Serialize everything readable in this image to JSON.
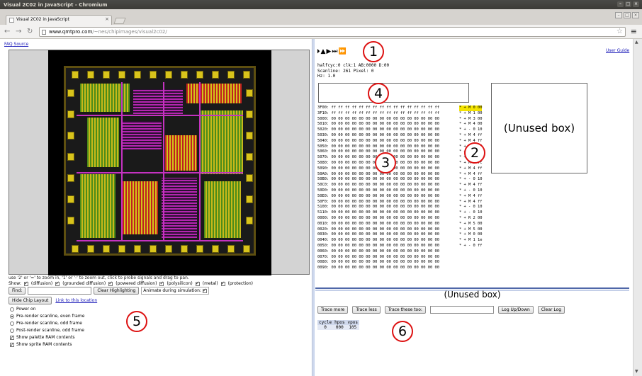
{
  "window": {
    "title": "Visual 2C02 in JavaScript - Chromium"
  },
  "tab": {
    "label": "Visual 2C02 in JavaScript",
    "close": "×"
  },
  "toolbar": {
    "url_host": "www.qmtpro.com",
    "url_path": "/~nes/chipimages/visual2c02/",
    "back": "←",
    "forward": "→",
    "reload": "↻",
    "star": "☆",
    "menu": "≡"
  },
  "links": {
    "faq": "FAQ",
    "source": "Source"
  },
  "chip_area": {
    "help": "use '2' or '=' to zoom in, '1' or '-' to zoom out, click to probe signals and drag to pan.",
    "show_label": "Show:",
    "layers": [
      {
        "label": "(diffusion)",
        "checked": true
      },
      {
        "label": "(grounded diffusion)",
        "checked": true
      },
      {
        "label": "(powered diffusion)",
        "checked": true
      },
      {
        "label": "(polysilicon)",
        "checked": true
      },
      {
        "label": "(metal)",
        "checked": true
      },
      {
        "label": "(protection)",
        "checked": true
      }
    ],
    "find_button": "Find:",
    "clear_button": "Clear Highlighting",
    "animate_label": "Animate during simulation:",
    "animate_checked": true,
    "hide_button": "Hide Chip Layout",
    "link_location": "Link to this location"
  },
  "options": [
    {
      "type": "radio",
      "label": "Power on",
      "checked": false
    },
    {
      "type": "radio",
      "label": "Pre-render scanline, even frame",
      "checked": true
    },
    {
      "type": "radio",
      "label": "Pre-render scanline, odd frame",
      "checked": false
    },
    {
      "type": "radio",
      "label": "Post-render scanline, odd frame",
      "checked": false
    },
    {
      "type": "checkbox",
      "label": "Show palette RAM contents",
      "checked": true
    },
    {
      "type": "checkbox",
      "label": "Show sprite RAM contents",
      "checked": true
    }
  ],
  "controls": {
    "buttons": [
      "⏵",
      "▲",
      "▶",
      "⏭",
      "⏩"
    ],
    "user_guide": "User Guide"
  },
  "status_lines": [
    "halfcyc:0 clk:1 AB:0000 D:00",
    "Scanline: 261 Pixel: 0",
    "Hz: 1.0"
  ],
  "memory_rows": [
    "3F00: ff ff ff ff ff ff ff ff ff ff ff ff ff ff ff ff",
    "3F10: ff ff ff ff ff ff ff ff ff ff ff ff ff ff ff ff",
    "5000: 00 00 00 00 00 00 00 00 00 00 00 00 00 00 00 00",
    "5010: 00 00 00 00 00 00 00 00 00 00 00 00 00 00 00 00",
    "5020: 00 00 00 00 00 00 00 00 00 00 00 00 00 00 00 00",
    "5030: 00 00 00 00 00 00 00 00 00 00 00 00 00 00 00 00",
    "5040: 00 00 00 00 00 00 00 00 00 00 00 00 00 00 00 00",
    "5050: 00 00 00 00 00 00 00 00 00 00 00 00 00 00 00 00",
    "5060: 00 00 00 00 00 00 00 00 00 00 00 00 00 00 00 00",
    "5070: 00 00 00 00 00 00 00 00 00 00 00 00 00 00 00 00",
    "5080: 00 00 00 00 00 00 00 00 00 00 00 00 00 00 00 00",
    "5090: 00 00 00 00 00 00 00 00 00 00 00 00 00 00 00 00",
    "50A0: 00 00 00 00 00 00 00 00 00 00 00 00 00 00 00 00",
    "50B0: 00 00 00 00 00 00 00 00 00 00 00 00 00 00 00 00",
    "50C0: 00 00 00 00 00 00 00 00 00 00 00 00 00 00 00 00",
    "50D0: 00 00 00 00 00 00 00 00 00 00 00 00 00 00 00 00",
    "50E0: 00 00 00 00 00 00 00 00 00 00 00 00 00 00 00 00",
    "50F0: 00 00 00 00 00 00 00 00 00 00 00 00 00 00 00 00",
    "5100: 00 00 00 00 00 00 00 00 00 00 00 00 00 00 00 00",
    "5110: 00 00 00 00 00 00 00 00 00 00 00 00 00 00 00 00",
    "0000: 00 00 00 00 00 00 00 00 00 00 00 00 00 00 00 00",
    "0010: 00 00 00 00 00 00 00 00 00 00 00 00 00 00 00 00",
    "0020: 00 00 00 00 00 00 00 00 00 00 00 00 00 00 00 00",
    "0030: 00 00 00 00 00 00 00 00 00 00 00 00 00 00 00 00",
    "0040: 00 00 00 00 00 00 00 00 00 00 00 00 00 00 00 00",
    "0050: 00 00 00 00 00 00 00 00 00 00 00 00 00 00 00 00",
    "0060: 00 00 00 00 00 00 00 00 00 00 00 00 00 00 00 00",
    "0070: 00 00 00 00 00 00 00 00 00 00 00 00 00 00 00 00",
    "0080: 00 00 00 00 00 00 00 00 00 00 00 00 00 00 00 00",
    "0090: 00 00 00 00 00 00 00 00 00 00 00 00 00 00 00 00"
  ],
  "oam_rows": [
    "* + M 0 00",
    "* + M 1 00",
    "* + M 3 00",
    "* + M 4 00",
    "* + - 0 10",
    "* + M 4 ff",
    "* + M 4 ff",
    "* + - 0 10",
    "* + - 0 10",
    "* + - 0 10",
    "* + M 3 fc",
    "* + M 4 ff",
    "* + M 4 ff",
    "* + - 0 10",
    "* + M 4 ff",
    "* + - 0 10",
    "* + M 4 ff",
    "* + M 4 ff",
    "* + - 0 10",
    "* + - 0 10",
    "* + R 2 00",
    "* + M 5 00",
    "* + M 5 00",
    "* + M 0 00",
    "* + M 1 1e",
    "* + - 0 ff"
  ],
  "unused_box_label": "(Unused box)",
  "trace": {
    "buttons": [
      "Trace more",
      "Trace less",
      "Trace these too:"
    ],
    "logbtns": [
      "Log Up/Down",
      "Clear Log"
    ],
    "headers": [
      "cycle",
      "hpos",
      "vpos"
    ],
    "row": [
      "0",
      "000",
      "105"
    ]
  },
  "annotations": [
    "1",
    "2",
    "3",
    "4",
    "5",
    "6"
  ],
  "colors": {
    "accent": "#d11111",
    "link": "#2222bb",
    "split": "#4f67a8"
  }
}
